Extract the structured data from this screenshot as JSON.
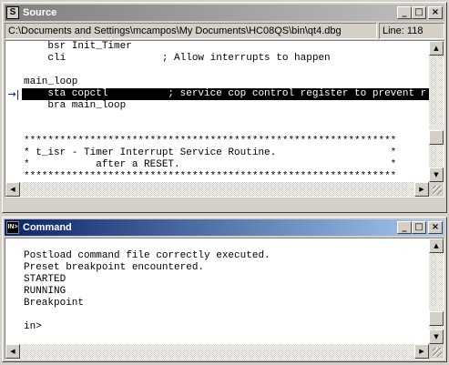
{
  "source_window": {
    "title": "Source",
    "icon_letter": "S",
    "path": "C:\\Documents and Settings\\mcampos\\My Documents\\HC08QS\\bin\\qt4.dbg",
    "line_indicator": "Line: 118",
    "lines": [
      "    bsr Init_Timer",
      "    cli                ; Allow interrupts to happen",
      "",
      "main_loop",
      "    sta copctl          ; service cop control register to prevent r",
      "    bra main_loop",
      "",
      "",
      "**************************************************************",
      "* t_isr - Timer Interrupt Service Routine.                   *",
      "*           after a RESET.                                   *",
      "**************************************************************"
    ],
    "highlighted_line": "    sta copctl          ; service cop control register to prevent r",
    "marker": "→|"
  },
  "command_window": {
    "title": "Command",
    "icon_text": "IN>",
    "lines": [
      "",
      "Postload command file correctly executed.",
      "Preset breakpoint encountered.",
      "STARTED",
      "RUNNING",
      "Breakpoint",
      "",
      "in>"
    ]
  },
  "window_controls": {
    "minimize": "_",
    "maximize": "□",
    "close": "×"
  },
  "scrollbar_glyphs": {
    "up": "▲",
    "down": "▼",
    "left": "◀",
    "right": "▶"
  }
}
